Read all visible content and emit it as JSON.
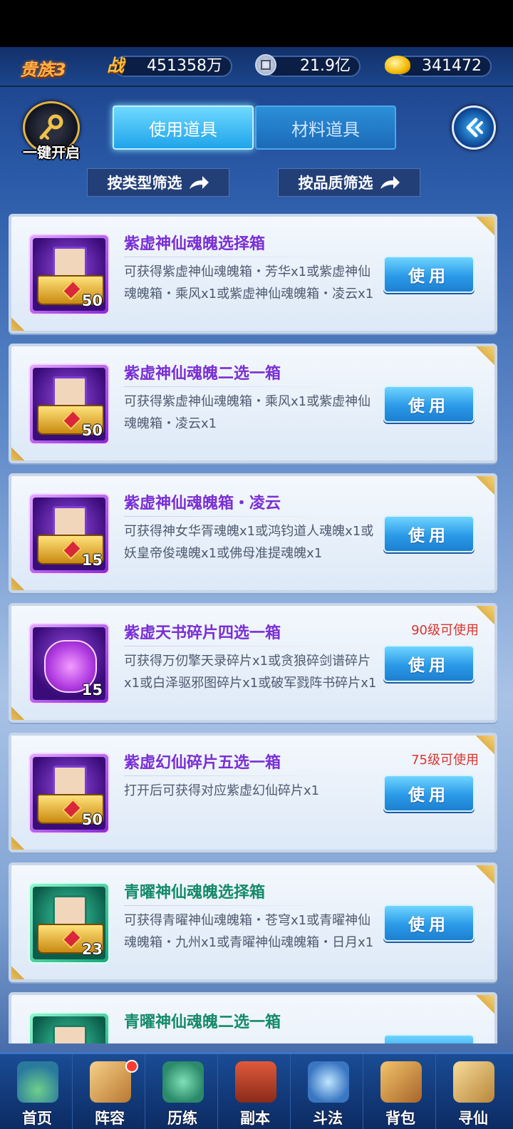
{
  "topbar": {
    "noble_label": "贵族3",
    "power_icon_label": "战",
    "power_value": "451358万",
    "silver_value": "21.9亿",
    "gold_value": "341472"
  },
  "toolbar": {
    "one_click_open": "一键开启",
    "tabs": [
      {
        "label": "使用道具",
        "active": true
      },
      {
        "label": "材料道具",
        "active": false
      }
    ],
    "filter_type": "按类型筛选",
    "filter_quality": "按品质筛选"
  },
  "items": [
    {
      "name": "紫虚神仙魂魄选择箱",
      "desc": "可获得紫虚神仙魂魄箱・芳华x1或紫虚神仙魂魄箱・乘风x1或紫虚神仙魂魄箱・凌云x1",
      "count": "50",
      "level_req": "",
      "button": "使用",
      "quality": "purple"
    },
    {
      "name": "紫虚神仙魂魄二选一箱",
      "desc": "可获得紫虚神仙魂魄箱・乘风x1或紫虚神仙魂魄箱・凌云x1",
      "count": "50",
      "level_req": "",
      "button": "使用",
      "quality": "purple"
    },
    {
      "name": "紫虚神仙魂魄箱・凌云",
      "desc": "可获得神女华胥魂魄x1或鸿钧道人魂魄x1或妖皇帝俊魂魄x1或佛母准提魂魄x1",
      "count": "15",
      "level_req": "",
      "button": "使用",
      "quality": "purple"
    },
    {
      "name": "紫虚天书碎片四选一箱",
      "desc": "可获得万仞擎天录碎片x1或贪狼碎剑谱碎片x1或白泽驱邪图碎片x1或破军戮阵书碎片x1",
      "count": "15",
      "level_req": "90级可使用",
      "button": "使用",
      "quality": "purple"
    },
    {
      "name": "紫虚幻仙碎片五选一箱",
      "desc": "打开后可获得对应紫虚幻仙碎片x1",
      "count": "50",
      "level_req": "75级可使用",
      "button": "使用",
      "quality": "purple"
    },
    {
      "name": "青曜神仙魂魄选择箱",
      "desc": "可获得青曜神仙魂魄箱・苍穹x1或青曜神仙魂魄箱・九州x1或青曜神仙魂魄箱・日月x1",
      "count": "23",
      "level_req": "",
      "button": "使用",
      "quality": "teal"
    },
    {
      "name": "青曜神仙魂魄二选一箱",
      "desc": "",
      "count": "",
      "level_req": "",
      "button": "使用",
      "quality": "teal"
    }
  ],
  "bottom_nav": [
    {
      "label": "首页",
      "icon": "home-icon"
    },
    {
      "label": "阵容",
      "icon": "lineup-icon",
      "badge": true
    },
    {
      "label": "历练",
      "icon": "training-icon"
    },
    {
      "label": "副本",
      "icon": "dungeon-icon"
    },
    {
      "label": "斗法",
      "icon": "battle-icon"
    },
    {
      "label": "背包",
      "icon": "backpack-icon"
    },
    {
      "label": "寻仙",
      "icon": "seek-immortal-icon"
    }
  ],
  "colors": {
    "purple_name": "#7a2fd4",
    "teal_name": "#148a6a",
    "level_req": "#d9342f",
    "button_blue": "#2b9ae8"
  }
}
